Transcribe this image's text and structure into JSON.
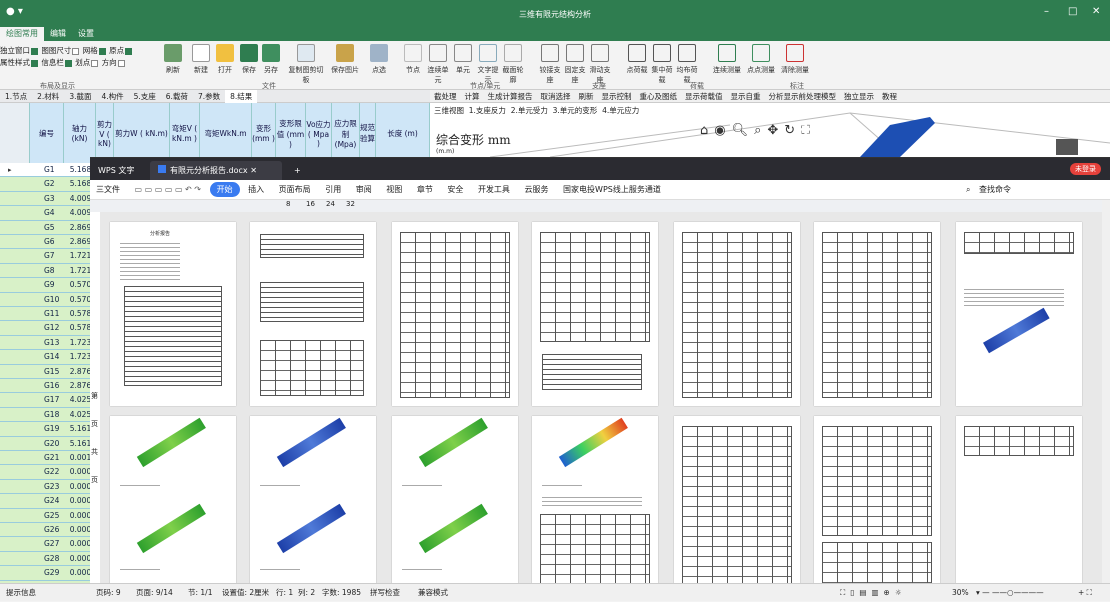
{
  "app": {
    "title": "三维有限元结构分析"
  },
  "menu": {
    "items": [
      "绘图常用",
      "编辑",
      "设置"
    ]
  },
  "ribbon": {
    "checks": [
      {
        "label": "独立窗口",
        "on": true
      },
      {
        "label": "图图尺寸",
        "on": false
      },
      {
        "label": "网格",
        "on": true
      },
      {
        "label": "原点",
        "on": true
      },
      {
        "label": "属性样式",
        "on": true
      },
      {
        "label": "信息栏",
        "on": true
      },
      {
        "label": "划点",
        "on": false
      },
      {
        "label": "方向",
        "on": false
      }
    ],
    "buttons_left": [
      "刷新",
      "新建",
      "打开",
      "保存",
      "另存",
      "复制图剪切板",
      "保存图片",
      "点选"
    ],
    "buttons_right": [
      "节点",
      "连续单元",
      "单元",
      "文字提示",
      "截面轮廓",
      "铰接支座",
      "固定支座",
      "滑动支座",
      "点荷载",
      "集中荷载",
      "均布荷载",
      "连续测量",
      "点点测量",
      "清除测量"
    ],
    "groups": [
      "布局及显示",
      "文件",
      "节点/单元",
      "支座",
      "荷载",
      "标注"
    ]
  },
  "tabs2": [
    "1.节点",
    "2.材料",
    "3.截面",
    "4.构件",
    "5.支座",
    "6.载荷",
    "7.参数",
    "8.结果"
  ],
  "toolbar2": [
    "截处理",
    "计算",
    "生成计算报告",
    "取消选择",
    "刷新",
    "显示控制",
    "重心及图纸",
    "显示荷载值",
    "显示自重",
    "分析显示前处理模型",
    "独立显示",
    "教程"
  ],
  "view": {
    "tabs": [
      "三维视图",
      "1.支座反力",
      "2.单元受力",
      "3.单元的变形",
      "4.单元应力"
    ],
    "heading": "综合变形 mm",
    "unit": "(m.m)"
  },
  "table": {
    "headers": [
      "编号",
      "轴力 (kN)",
      "剪力V ( kN)",
      "剪力W ( kN.m)",
      "弯矩V ( kN.m )",
      "弯矩WkN.m",
      "变形 (mm )",
      "变形限值 (mm )",
      "Vo应力 ( Mpa )",
      "应力限制 (Mpa)",
      "规范验算",
      "长度 (m)"
    ],
    "rows": [
      {
        "id": "G1",
        "v": "5.168"
      },
      {
        "id": "G2",
        "v": "5.168"
      },
      {
        "id": "G3",
        "v": "4.009"
      },
      {
        "id": "G4",
        "v": "4.009"
      },
      {
        "id": "G5",
        "v": "2.869"
      },
      {
        "id": "G6",
        "v": "2.869"
      },
      {
        "id": "G7",
        "v": "1.721"
      },
      {
        "id": "G8",
        "v": "1.721"
      },
      {
        "id": "G9",
        "v": "0.570"
      },
      {
        "id": "G10",
        "v": "0.570"
      },
      {
        "id": "G11",
        "v": "0.578"
      },
      {
        "id": "G12",
        "v": "0.578"
      },
      {
        "id": "G13",
        "v": "1.723"
      },
      {
        "id": "G14",
        "v": "1.723"
      },
      {
        "id": "G15",
        "v": "2.876"
      },
      {
        "id": "G16",
        "v": "2.876"
      },
      {
        "id": "G17",
        "v": "4.025"
      },
      {
        "id": "G18",
        "v": "4.025"
      },
      {
        "id": "G19",
        "v": "5.161"
      },
      {
        "id": "G20",
        "v": "5.161"
      },
      {
        "id": "G21",
        "v": "0.001"
      },
      {
        "id": "G22",
        "v": "0.000"
      },
      {
        "id": "G23",
        "v": "0.000"
      },
      {
        "id": "G24",
        "v": "0.000"
      },
      {
        "id": "G25",
        "v": "0.000"
      },
      {
        "id": "G26",
        "v": "0.000"
      },
      {
        "id": "G27",
        "v": "0.000"
      },
      {
        "id": "G28",
        "v": "0.000"
      },
      {
        "id": "G29",
        "v": "0.000"
      },
      {
        "id": "G30",
        "v": "0.000"
      }
    ]
  },
  "wps": {
    "app_tab": "WPS 文字",
    "doc_tab": "有限元分析报告.docx",
    "login": "未登录",
    "menu": [
      "三文件",
      "开始",
      "插入",
      "页面布局",
      "引用",
      "审阅",
      "视图",
      "章节",
      "安全",
      "开发工具",
      "云服务",
      "国家电投WPS线上服务通道"
    ],
    "search": "查找命令",
    "ruler": [
      "8",
      "16",
      "24",
      "32"
    ],
    "page_title": "分析报告",
    "side_marks": [
      "第",
      "页",
      "共",
      "页"
    ]
  },
  "statusbar": {
    "left": "提示信息",
    "items": [
      "页码: 9",
      "页面: 9/14",
      "节: 1/1",
      "设置值: 2厘米",
      "行: 1",
      "列: 2",
      "字数: 1985",
      "拼写检查",
      "兼容模式"
    ],
    "zoom": "30%"
  },
  "colors": {
    "brand": "#2f7d50",
    "wps_dark": "#2b2b31",
    "accent": "#3a7bf0",
    "login": "#e5413b"
  }
}
